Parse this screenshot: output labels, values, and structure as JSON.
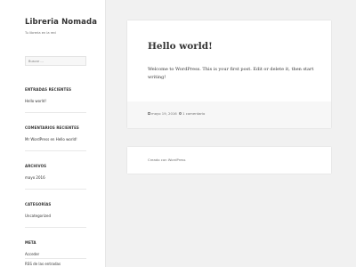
{
  "site": {
    "title": "Libreria Nomada",
    "description": "Tu libreria en la red"
  },
  "search": {
    "placeholder": "Buscar ..."
  },
  "widgets": {
    "recent_posts": {
      "title": "ENTRADAS RECIENTES",
      "items": [
        "Hello world!"
      ]
    },
    "recent_comments": {
      "title": "COMENTARIOS RECIENTES",
      "items": [
        "Mr WordPress en Hello world!"
      ]
    },
    "archives": {
      "title": "ARCHIVOS",
      "items": [
        "mayo 2016"
      ]
    },
    "categories": {
      "title": "CATEGORÍAS",
      "items": [
        "Uncategorized"
      ]
    },
    "meta": {
      "title": "META",
      "items": [
        "Acceder",
        "RSS de las entradas"
      ]
    }
  },
  "post": {
    "title": "Hello world!",
    "body": "Welcome to WordPress. This is your first post. Edit or delete it, then start writing!",
    "date": "mayo 19, 2016",
    "comments": "1 comentario"
  },
  "footer": {
    "credit": "Creado con WordPress"
  },
  "colors": {
    "background": "#f1f1f1",
    "card": "#ffffff",
    "text": "#333333",
    "muted": "#707070"
  }
}
